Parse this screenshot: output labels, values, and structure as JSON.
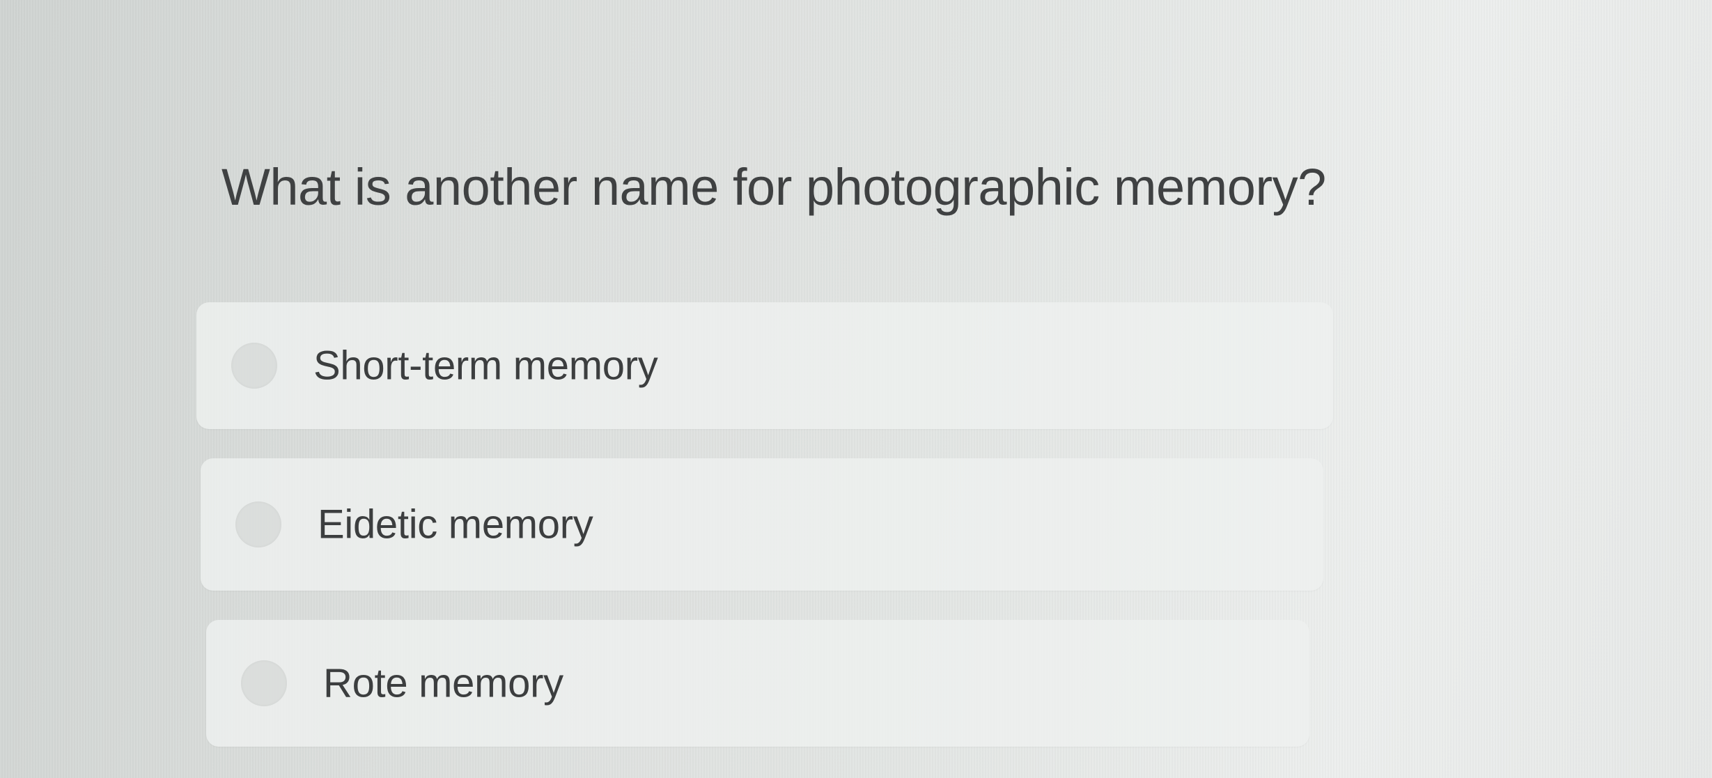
{
  "question": {
    "text": "What is another name for photographic memory?"
  },
  "options": [
    {
      "label": "Short-term memory",
      "selected": false
    },
    {
      "label": "Eidetic memory",
      "selected": false
    },
    {
      "label": "Rote memory",
      "selected": false
    }
  ]
}
